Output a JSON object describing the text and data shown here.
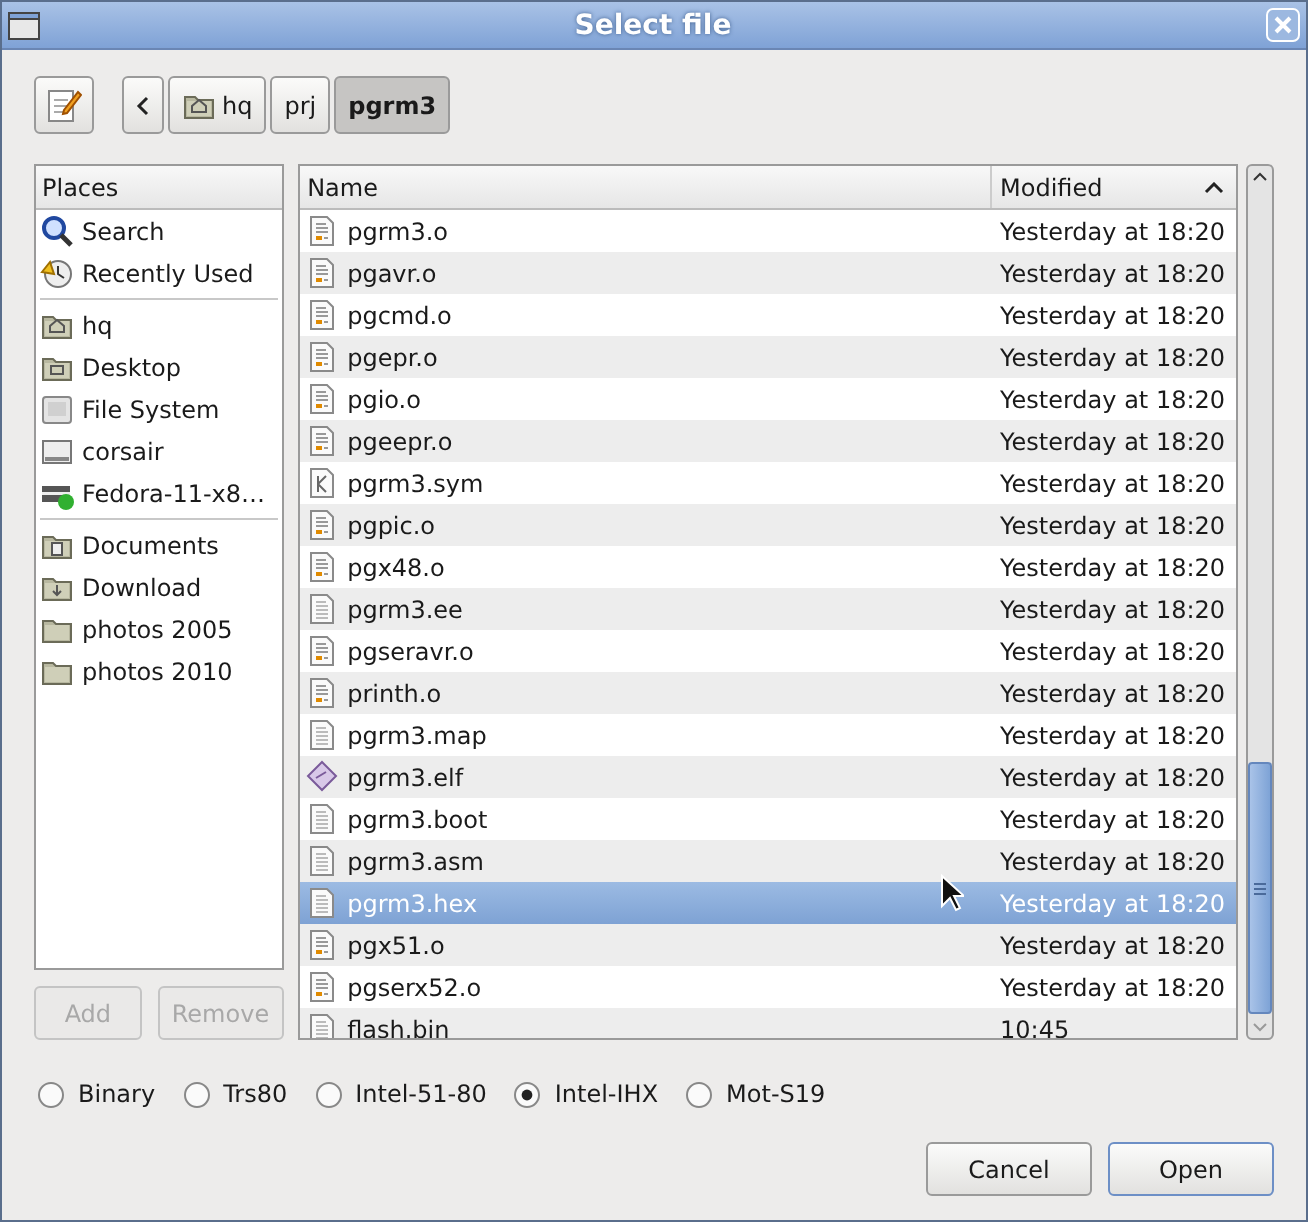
{
  "window": {
    "title": "Select file"
  },
  "toolbar": {
    "path": [
      {
        "label": "hq",
        "kind": "home",
        "selected": false
      },
      {
        "label": "prj",
        "kind": "plain",
        "selected": false
      },
      {
        "label": "pgrm3",
        "kind": "plain",
        "selected": true
      }
    ]
  },
  "places": {
    "header": "Places",
    "groups": [
      [
        {
          "label": "Search",
          "kind": "search"
        },
        {
          "label": "Recently Used",
          "kind": "recent"
        }
      ],
      [
        {
          "label": "hq",
          "kind": "home"
        },
        {
          "label": "Desktop",
          "kind": "desktop"
        },
        {
          "label": "File System",
          "kind": "filesystem"
        },
        {
          "label": "corsair",
          "kind": "drive"
        },
        {
          "label": "Fedora-11-x8…",
          "kind": "usb"
        }
      ],
      [
        {
          "label": "Documents",
          "kind": "documents"
        },
        {
          "label": "Download",
          "kind": "download"
        },
        {
          "label": "photos 2005",
          "kind": "folder"
        },
        {
          "label": "photos 2010",
          "kind": "folder"
        }
      ]
    ],
    "buttons": [
      {
        "label": "Add",
        "disabled": true
      },
      {
        "label": "Remove",
        "disabled": true
      }
    ]
  },
  "files": {
    "columns": [
      "Name",
      "Modified"
    ],
    "rows": [
      {
        "name": "pgrm3.o",
        "modified": "Yesterday at 18:20",
        "kind": "object",
        "selected": false
      },
      {
        "name": "pgavr.o",
        "modified": "Yesterday at 18:20",
        "kind": "object",
        "selected": false
      },
      {
        "name": "pgcmd.o",
        "modified": "Yesterday at 18:20",
        "kind": "object",
        "selected": false
      },
      {
        "name": "pgepr.o",
        "modified": "Yesterday at 18:20",
        "kind": "object",
        "selected": false
      },
      {
        "name": "pgio.o",
        "modified": "Yesterday at 18:20",
        "kind": "object",
        "selected": false
      },
      {
        "name": "pgeepr.o",
        "modified": "Yesterday at 18:20",
        "kind": "object",
        "selected": false
      },
      {
        "name": "pgrm3.sym",
        "modified": "Yesterday at 18:20",
        "kind": "symbols",
        "selected": false
      },
      {
        "name": "pgpic.o",
        "modified": "Yesterday at 18:20",
        "kind": "object",
        "selected": false
      },
      {
        "name": "pgx48.o",
        "modified": "Yesterday at 18:20",
        "kind": "object",
        "selected": false
      },
      {
        "name": "pgrm3.ee",
        "modified": "Yesterday at 18:20",
        "kind": "text",
        "selected": false
      },
      {
        "name": "pgseravr.o",
        "modified": "Yesterday at 18:20",
        "kind": "object",
        "selected": false
      },
      {
        "name": "printh.o",
        "modified": "Yesterday at 18:20",
        "kind": "object",
        "selected": false
      },
      {
        "name": "pgrm3.map",
        "modified": "Yesterday at 18:20",
        "kind": "text",
        "selected": false
      },
      {
        "name": "pgrm3.elf",
        "modified": "Yesterday at 18:20",
        "kind": "executable",
        "selected": false
      },
      {
        "name": "pgrm3.boot",
        "modified": "Yesterday at 18:20",
        "kind": "text",
        "selected": false
      },
      {
        "name": "pgrm3.asm",
        "modified": "Yesterday at 18:20",
        "kind": "text",
        "selected": false
      },
      {
        "name": "pgrm3.hex",
        "modified": "Yesterday at 18:20",
        "kind": "text",
        "selected": true
      },
      {
        "name": "pgx51.o",
        "modified": "Yesterday at 18:20",
        "kind": "object",
        "selected": false
      },
      {
        "name": "pgserx52.o",
        "modified": "Yesterday at 18:20",
        "kind": "object",
        "selected": false
      },
      {
        "name": "flash.bin",
        "modified": "10:45",
        "kind": "text",
        "selected": false
      }
    ]
  },
  "formats": [
    {
      "label": "Binary",
      "selected": false
    },
    {
      "label": "Trs80",
      "selected": false
    },
    {
      "label": "Intel-51-80",
      "selected": false
    },
    {
      "label": "Intel-IHX",
      "selected": true
    },
    {
      "label": "Mot-S19",
      "selected": false
    }
  ],
  "actions": [
    {
      "label": "Cancel",
      "default": false
    },
    {
      "label": "Open",
      "default": true
    }
  ]
}
